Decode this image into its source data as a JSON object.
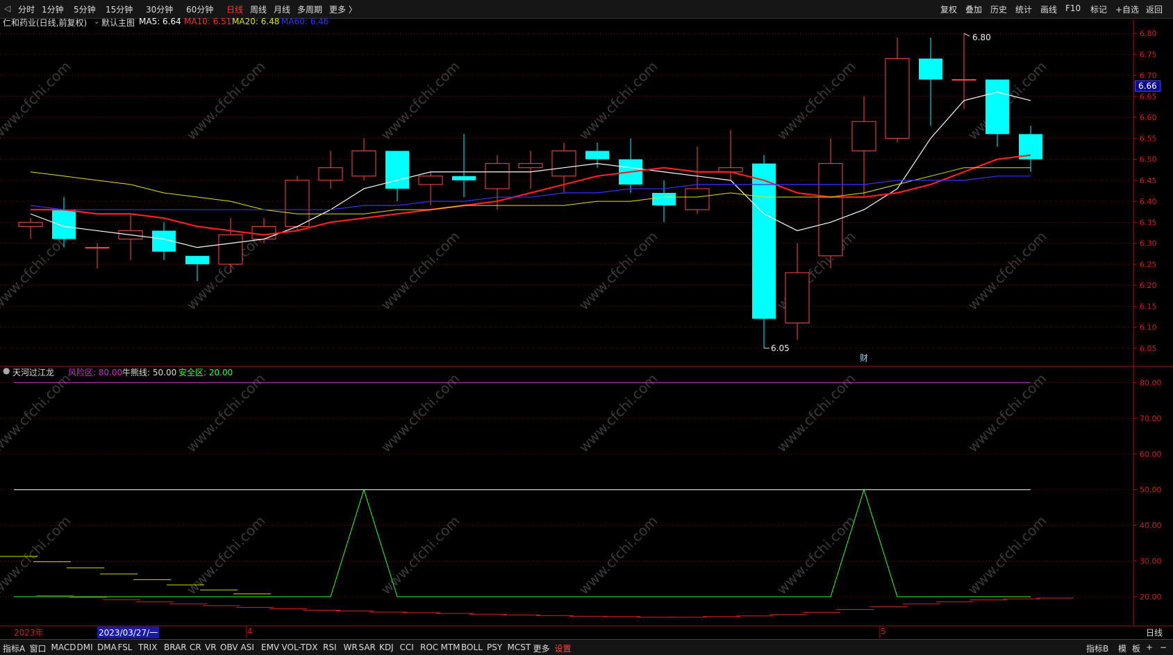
{
  "toolbar": {
    "left_items": [
      "分时",
      "1分钟",
      "5分钟",
      "15分钟",
      "30分钟",
      "60分钟",
      "日线",
      "周线",
      "月线",
      "多周期",
      "更多 〉"
    ],
    "active_item": "日线",
    "right_items": [
      "复权",
      "叠加",
      "历史",
      "统计",
      "画线",
      "F10",
      "标记",
      "+自选",
      "返回"
    ]
  },
  "main_chart": {
    "stock_title": "仁和药业(日线,前复权)",
    "template_label": "默认主图",
    "ma5_label": "MA5: 6.64",
    "ma10_label": "MA10: 6.51",
    "ma20_label": "MA20: 6.48",
    "ma60_label": "MA60: 6.46",
    "current_price": "6.66",
    "high_label": "6.80",
    "low_label": "6.05",
    "event_marker": "财"
  },
  "indicator": {
    "name": "天河过江龙",
    "risk_label": "风险区: 80.00",
    "bull_label": "牛熊线: 50.00",
    "safe_label": "安全区: 20.00"
  },
  "date_axis": {
    "year_label": "2023年",
    "cursor_label": "2023/03/27/一",
    "month_labels": [
      "4",
      "5"
    ],
    "period_label": "日线"
  },
  "bottom_tabs": {
    "items": [
      "指标A",
      "窗口",
      "MACD",
      "DMI",
      "DMA",
      "FSL",
      "TRIX",
      "BRAR",
      "CR",
      "VR",
      "OBV",
      "ASI",
      "EMV",
      "VOL-TDX",
      "RSI",
      "WR",
      "SAR",
      "KDJ",
      "CCI",
      "ROC",
      "MTM",
      "BOLL",
      "PSY",
      "MCST",
      "更多",
      "设置"
    ],
    "right_items": [
      "指标B",
      "模",
      "板",
      "+",
      "−"
    ]
  },
  "watermark_text": "www.cfchi.com",
  "colors": {
    "up": "#ff4d4d",
    "down": "#00ffff",
    "ma5": "#ffffff",
    "ma10": "#ff2020",
    "ma20": "#e6e600",
    "ma60": "#3333ff",
    "risk": "#cc33cc",
    "safe": "#33ff33",
    "grid": "#7a1010"
  },
  "chart_data": [
    {
      "type": "candlestick",
      "title": "仁和药业(日线,前复权)",
      "ylim": [
        6.02,
        6.82
      ],
      "y_ticks": [
        6.05,
        6.1,
        6.15,
        6.2,
        6.25,
        6.3,
        6.35,
        6.4,
        6.45,
        6.5,
        6.55,
        6.6,
        6.65,
        6.7,
        6.75,
        6.8
      ],
      "candles": [
        {
          "o": 6.34,
          "c": 6.35,
          "h": 6.36,
          "l": 6.31
        },
        {
          "o": 6.38,
          "c": 6.31,
          "h": 6.41,
          "l": 6.29
        },
        {
          "o": 6.29,
          "c": 6.29,
          "h": 6.3,
          "l": 6.24
        },
        {
          "o": 6.31,
          "c": 6.33,
          "h": 6.37,
          "l": 6.26
        },
        {
          "o": 6.33,
          "c": 6.28,
          "h": 6.35,
          "l": 6.26
        },
        {
          "o": 6.27,
          "c": 6.25,
          "h": 6.27,
          "l": 6.21
        },
        {
          "o": 6.25,
          "c": 6.32,
          "h": 6.36,
          "l": 6.23
        },
        {
          "o": 6.31,
          "c": 6.34,
          "h": 6.36,
          "l": 6.3
        },
        {
          "o": 6.34,
          "c": 6.45,
          "h": 6.46,
          "l": 6.33
        },
        {
          "o": 6.45,
          "c": 6.48,
          "h": 6.52,
          "l": 6.43
        },
        {
          "o": 6.46,
          "c": 6.52,
          "h": 6.55,
          "l": 6.45
        },
        {
          "o": 6.52,
          "c": 6.43,
          "h": 6.52,
          "l": 6.4
        },
        {
          "o": 6.44,
          "c": 6.46,
          "h": 6.47,
          "l": 6.39
        },
        {
          "o": 6.46,
          "c": 6.45,
          "h": 6.56,
          "l": 6.41
        },
        {
          "o": 6.43,
          "c": 6.49,
          "h": 6.51,
          "l": 6.38
        },
        {
          "o": 6.48,
          "c": 6.49,
          "h": 6.52,
          "l": 6.43
        },
        {
          "o": 6.46,
          "c": 6.52,
          "h": 6.54,
          "l": 6.42
        },
        {
          "o": 6.52,
          "c": 6.5,
          "h": 6.54,
          "l": 6.48
        },
        {
          "o": 6.5,
          "c": 6.44,
          "h": 6.55,
          "l": 6.42
        },
        {
          "o": 6.42,
          "c": 6.39,
          "h": 6.45,
          "l": 6.35
        },
        {
          "o": 6.38,
          "c": 6.43,
          "h": 6.53,
          "l": 6.37
        },
        {
          "o": 6.47,
          "c": 6.48,
          "h": 6.57,
          "l": 6.45
        },
        {
          "o": 6.49,
          "c": 6.12,
          "h": 6.51,
          "l": 6.05
        },
        {
          "o": 6.11,
          "c": 6.23,
          "h": 6.3,
          "l": 6.07
        },
        {
          "o": 6.27,
          "c": 6.49,
          "h": 6.55,
          "l": 6.24
        },
        {
          "o": 6.52,
          "c": 6.59,
          "h": 6.65,
          "l": 6.41
        },
        {
          "o": 6.55,
          "c": 6.74,
          "h": 6.79,
          "l": 6.54
        },
        {
          "o": 6.74,
          "c": 6.69,
          "h": 6.79,
          "l": 6.58
        },
        {
          "o": 6.69,
          "c": 6.69,
          "h": 6.8,
          "l": 6.62
        },
        {
          "o": 6.69,
          "c": 6.56,
          "h": 6.69,
          "l": 6.53
        },
        {
          "o": 6.56,
          "c": 6.5,
          "h": 6.58,
          "l": 6.47
        }
      ],
      "series": [
        {
          "name": "MA5",
          "values": [
            6.37,
            6.34,
            6.33,
            6.32,
            6.31,
            6.29,
            6.3,
            6.31,
            6.34,
            6.38,
            6.43,
            6.45,
            6.47,
            6.47,
            6.47,
            6.47,
            6.48,
            6.49,
            6.48,
            6.47,
            6.46,
            6.45,
            6.37,
            6.33,
            6.35,
            6.38,
            6.43,
            6.55,
            6.64,
            6.66,
            6.64
          ]
        },
        {
          "name": "MA10",
          "values": [
            6.38,
            6.38,
            6.37,
            6.37,
            6.36,
            6.34,
            6.33,
            6.32,
            6.33,
            6.35,
            6.36,
            6.37,
            6.38,
            6.39,
            6.4,
            6.42,
            6.44,
            6.46,
            6.47,
            6.48,
            6.47,
            6.47,
            6.45,
            6.42,
            6.41,
            6.41,
            6.42,
            6.44,
            6.47,
            6.5,
            6.51
          ]
        },
        {
          "name": "MA20",
          "values": [
            6.47,
            6.46,
            6.45,
            6.44,
            6.42,
            6.41,
            6.4,
            6.38,
            6.37,
            6.37,
            6.37,
            6.38,
            6.38,
            6.39,
            6.39,
            6.39,
            6.39,
            6.4,
            6.4,
            6.41,
            6.41,
            6.42,
            6.41,
            6.41,
            6.41,
            6.42,
            6.44,
            6.46,
            6.48,
            6.48,
            6.48
          ]
        },
        {
          "name": "MA60",
          "values": [
            6.39,
            6.38,
            6.38,
            6.38,
            6.38,
            6.38,
            6.38,
            6.38,
            6.38,
            6.38,
            6.39,
            6.39,
            6.4,
            6.4,
            6.41,
            6.41,
            6.42,
            6.42,
            6.43,
            6.43,
            6.44,
            6.44,
            6.44,
            6.44,
            6.44,
            6.44,
            6.45,
            6.45,
            6.45,
            6.46,
            6.46
          ]
        }
      ]
    },
    {
      "type": "line",
      "title": "天河过江龙",
      "ylim": [
        13,
        83
      ],
      "y_ticks": [
        20,
        30,
        40,
        50,
        60,
        70,
        80
      ],
      "reference_lines": [
        {
          "name": "风险区",
          "value": 80
        },
        {
          "name": "牛熊线",
          "value": 50
        },
        {
          "name": "安全区",
          "value": 20
        }
      ],
      "series": [
        {
          "name": "signal",
          "values": [
            20,
            20,
            20,
            20,
            20,
            20,
            20,
            20,
            20,
            20,
            50,
            20,
            20,
            20,
            20,
            20,
            20,
            20,
            20,
            20,
            20,
            20,
            20,
            20,
            20,
            50,
            20,
            20,
            20,
            20,
            20
          ]
        },
        {
          "name": "upper_steps",
          "values": [
            31.3,
            29.8,
            28.1,
            26.4,
            24.8,
            23.3,
            21.9,
            20.8
          ]
        },
        {
          "name": "lower_steps",
          "values": [
            20.3,
            19.8,
            19.2,
            18.6,
            18.0,
            17.5,
            17.0,
            16.6,
            16.2,
            16.0,
            15.7,
            15.5,
            15.3,
            15.1,
            14.9,
            14.7,
            14.5,
            14.4,
            14.3,
            14.3,
            14.4,
            14.6,
            15.0,
            15.6,
            16.4,
            17.2,
            18.0,
            18.6,
            19.1,
            19.4,
            19.6
          ]
        }
      ]
    }
  ]
}
